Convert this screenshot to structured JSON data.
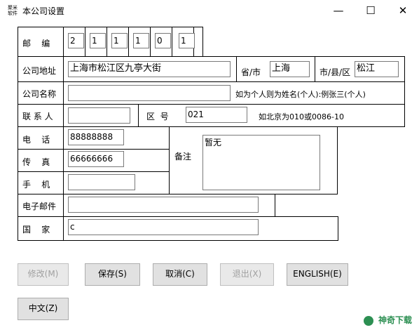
{
  "window": {
    "icon_text": "聚米\n软件",
    "title": "本公司设置",
    "minimize": "—",
    "maximize": "☐",
    "close": "✕"
  },
  "form": {
    "zip_label": "邮    编",
    "zip_digits": [
      "2",
      "1",
      "1",
      "1",
      "0",
      "1"
    ],
    "address_label": "公司地址",
    "address_value": "上海市松江区九亭大街",
    "province_label": "省/市",
    "province_value": "上海",
    "city_label": "市/县/区",
    "city_value": "松江",
    "company_label": "公司名称",
    "company_value": "",
    "company_note": "如为个人则为姓名(个人):例张三(个人)",
    "contact_label": "联 系 人",
    "contact_value": "",
    "area_label": "区  号",
    "area_value": "021",
    "area_note": "如北京为010或0086-10",
    "phone_label": "电    话",
    "phone_value": "88888888",
    "fax_label": "传    真",
    "fax_value": "66666666",
    "mobile_label": "手    机",
    "mobile_value": "",
    "remark_label": "备注",
    "remark_value": "暂无",
    "email_label": "电子邮件",
    "email_value": "",
    "country_label": "国    家",
    "country_value": "c"
  },
  "buttons": {
    "modify": "修改(M)",
    "save": "保存(S)",
    "cancel": "取消(C)",
    "exit": "退出(X)",
    "english": "ENGLISH(E)",
    "chinese": "中文(Z)"
  },
  "watermark": "神奇下载"
}
